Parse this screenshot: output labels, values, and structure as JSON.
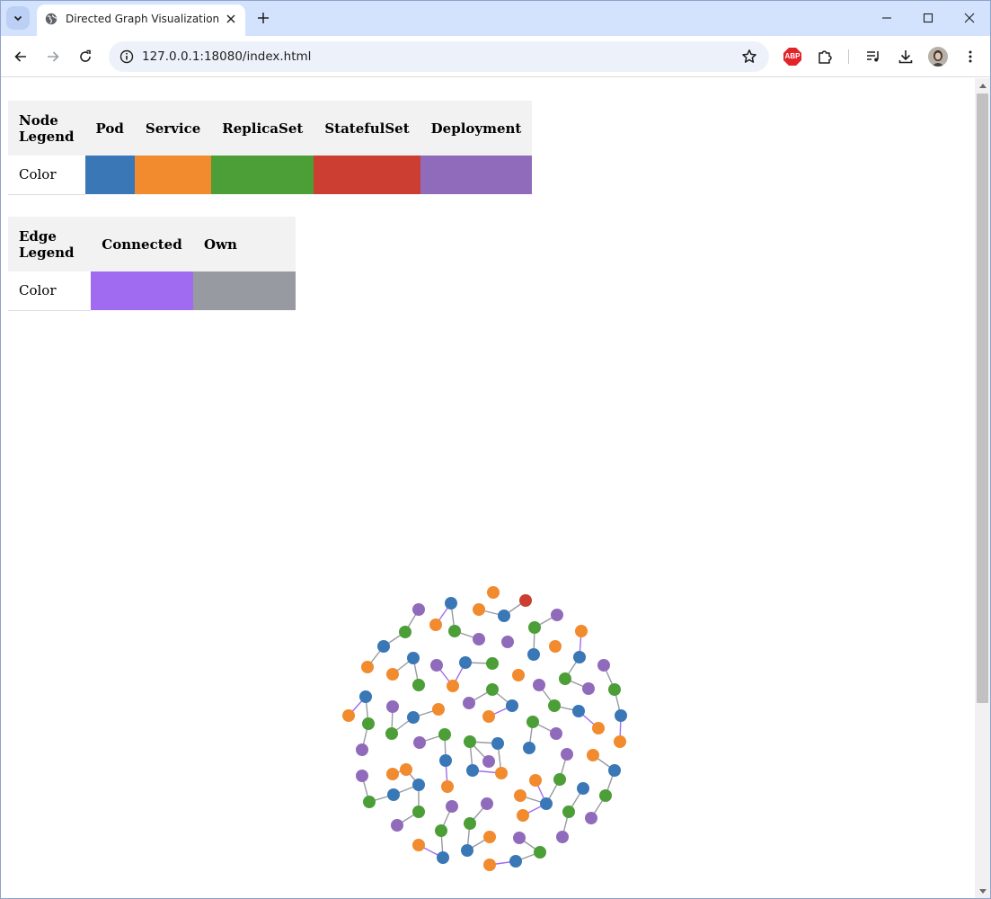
{
  "browser": {
    "tab_title": "Directed Graph Visualization",
    "url": "127.0.0.1:18080/index.html",
    "extension_badge": "ABP"
  },
  "node_legend": {
    "header": "Node Legend",
    "row_label": "Color",
    "columns": [
      {
        "label": "Pod",
        "color": "#3a77b6"
      },
      {
        "label": "Service",
        "color": "#f28a2e"
      },
      {
        "label": "ReplicaSet",
        "color": "#4c9e37"
      },
      {
        "label": "StatefulSet",
        "color": "#cb3e31"
      },
      {
        "label": "Deployment",
        "color": "#916bbb"
      }
    ]
  },
  "edge_legend": {
    "header": "Edge Legend",
    "row_label": "Color",
    "columns": [
      {
        "label": "Connected",
        "color": "#a06bf0"
      },
      {
        "label": "Own",
        "color": "#979aa1"
      }
    ]
  },
  "graph": {
    "node_type_counts": {
      "Pod": 27,
      "Service": 30,
      "ReplicaSet": 27,
      "StatefulSet": 1,
      "Deployment": 28
    }
  }
}
